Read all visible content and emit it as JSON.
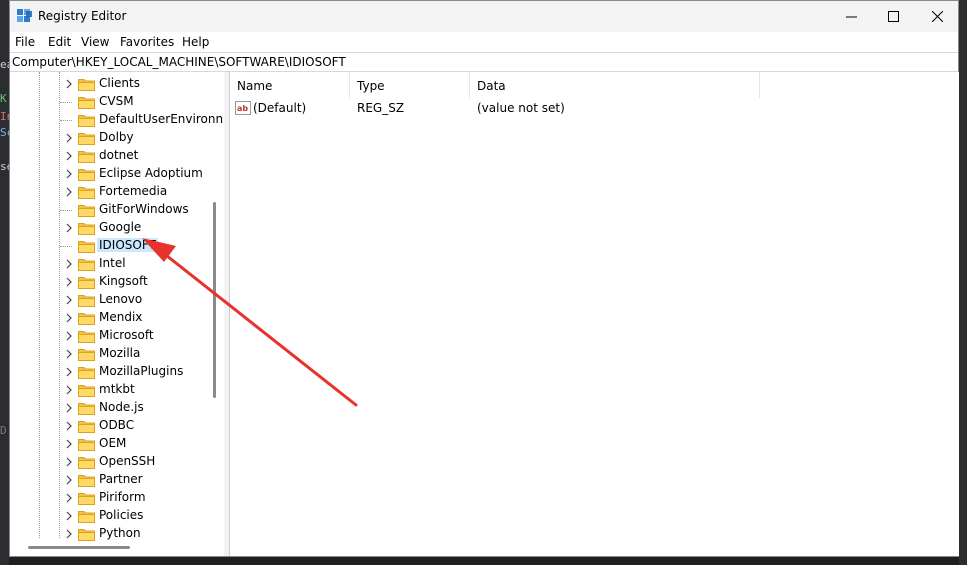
{
  "background": {
    "fragments": [
      "ea",
      "K",
      "In",
      "Sc",
      "se",
      "D"
    ]
  },
  "window": {
    "title": "Registry Editor",
    "controls": {
      "minimize": "minimize",
      "maximize": "maximize",
      "close": "close"
    }
  },
  "menu": {
    "items": [
      "File",
      "Edit",
      "View",
      "Favorites",
      "Help"
    ]
  },
  "address": {
    "path": "Computer\\HKEY_LOCAL_MACHINE\\SOFTWARE\\IDIOSOFT"
  },
  "tree": {
    "items": [
      {
        "label": "Clients",
        "expandable": true
      },
      {
        "label": "CVSM",
        "expandable": false
      },
      {
        "label": "DefaultUserEnvironn",
        "expandable": false
      },
      {
        "label": "Dolby",
        "expandable": true
      },
      {
        "label": "dotnet",
        "expandable": true
      },
      {
        "label": "Eclipse Adoptium",
        "expandable": true
      },
      {
        "label": "Fortemedia",
        "expandable": true
      },
      {
        "label": "GitForWindows",
        "expandable": false
      },
      {
        "label": "Google",
        "expandable": true
      },
      {
        "label": "IDIOSOFT",
        "expandable": false,
        "selected": true
      },
      {
        "label": "Intel",
        "expandable": true
      },
      {
        "label": "Kingsoft",
        "expandable": true
      },
      {
        "label": "Lenovo",
        "expandable": true
      },
      {
        "label": "Mendix",
        "expandable": true
      },
      {
        "label": "Microsoft",
        "expandable": true
      },
      {
        "label": "Mozilla",
        "expandable": true
      },
      {
        "label": "MozillaPlugins",
        "expandable": true
      },
      {
        "label": "mtkbt",
        "expandable": true
      },
      {
        "label": "Node.js",
        "expandable": true
      },
      {
        "label": "ODBC",
        "expandable": true
      },
      {
        "label": "OEM",
        "expandable": true
      },
      {
        "label": "OpenSSH",
        "expandable": true
      },
      {
        "label": "Partner",
        "expandable": true
      },
      {
        "label": "Piriform",
        "expandable": true
      },
      {
        "label": "Policies",
        "expandable": true
      },
      {
        "label": "Python",
        "expandable": true
      }
    ]
  },
  "list": {
    "columns": {
      "name": "Name",
      "type": "Type",
      "data": "Data"
    },
    "rows": [
      {
        "name": "(Default)",
        "type": "REG_SZ",
        "data": "(value not set)",
        "icon": "string-value-icon"
      }
    ]
  },
  "annotation": {
    "color": "#e8332c",
    "icon": "red-arrow"
  },
  "colors": {
    "selection": "#cce8ff",
    "folder": "#f5c542"
  }
}
